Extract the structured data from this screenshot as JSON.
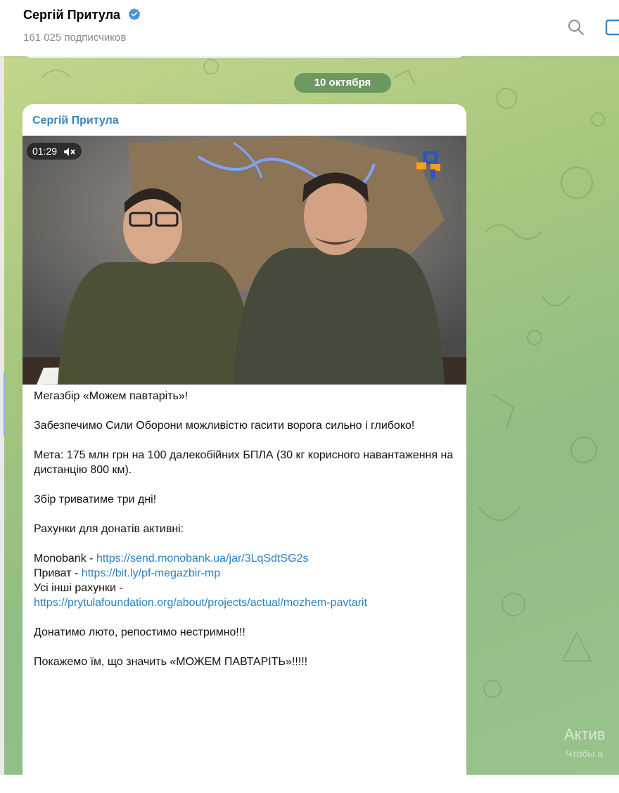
{
  "header": {
    "channel_name": "Сергій Притула",
    "subscribers": "161 025 подписчиков"
  },
  "chat": {
    "date_badge": "10 октября",
    "message": {
      "author": "Сергій Притула",
      "video_duration": "01:29",
      "lines": {
        "title": "Мегазбір «Можем павтаріть»!",
        "p1": "Забезпечимо Сили Оборони можливістю гасити ворога сильно і глибоко!",
        "p2": "Мета: 175 млн грн на 100 далекобійних БПЛА (30 кг корисного навантаження на дистанцію 800 км).",
        "p3": "Збір триватиме три дні!",
        "p4": "Рахунки для донатів активні:",
        "mono_label": "Monobank - ",
        "mono_link": "https://send.monobank.ua/jar/3LqSdtSG2s",
        "privat_label": "Приват - ",
        "privat_link": "https://bit.ly/pf-megazbir-mp",
        "other_label": "Усі інші рахунки -",
        "other_link": "https://prytulafoundation.org/about/projects/actual/mozhem-pavtarit",
        "p6": "Донатимо люто, репостимо нестримно!!!",
        "p7": "Покажемо їм, що значить «МОЖЕМ ПАВТАРІТЬ»!!!!!"
      }
    }
  },
  "watermark": {
    "title": "Актив",
    "sub": "Чтобы а"
  },
  "colors": {
    "link": "#2d7fc1",
    "author": "#3a86c0",
    "verified": "#4a95d6"
  },
  "icons": [
    "verified-badge-icon",
    "search-icon",
    "side-panel-icon",
    "mute-icon",
    "channel-logo-icon"
  ]
}
